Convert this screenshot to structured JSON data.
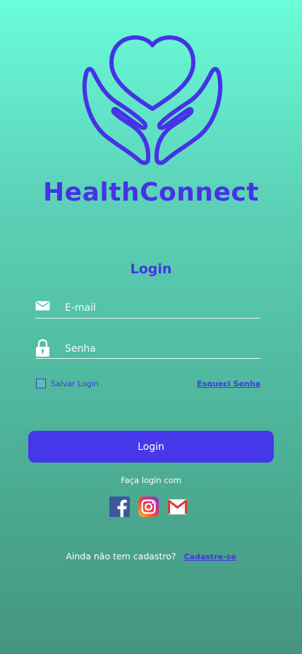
{
  "app": {
    "name": "HealthConnect",
    "logo_icon": "heart-hands-icon",
    "brand_color": "#4633e6"
  },
  "login": {
    "title": "Login",
    "email_placeholder": "E-mail",
    "password_placeholder": "Senha",
    "remember_label": "Salvar Login",
    "forgot_label": "Esqueci Senha",
    "button_label": "Login"
  },
  "social": {
    "title": "Faça login com",
    "providers": [
      {
        "name": "facebook",
        "icon": "facebook-icon"
      },
      {
        "name": "instagram",
        "icon": "instagram-icon"
      },
      {
        "name": "gmail",
        "icon": "gmail-icon"
      }
    ]
  },
  "register": {
    "prompt": "Ainda não tem cadastro?",
    "link_label": "Cadastre-se"
  }
}
